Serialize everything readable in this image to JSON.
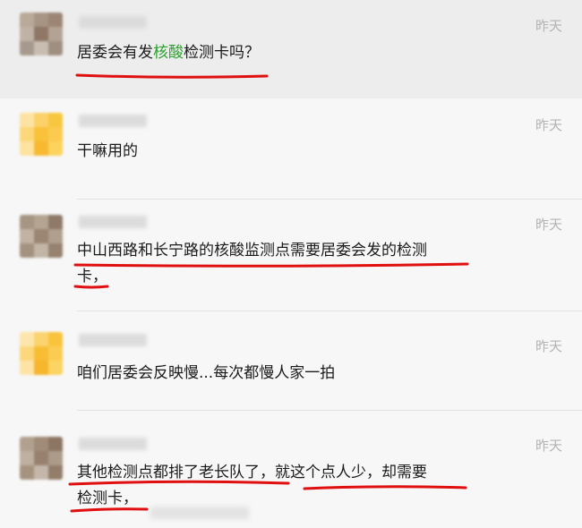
{
  "comments": [
    {
      "time": "昨天",
      "text_pre": "居委会有发",
      "text_highlight": "核酸",
      "text_post": "检测卡吗？",
      "avatar_colors": [
        "#b8a999",
        "#a89484",
        "#9c8574",
        "#c0b3a6",
        "#8f7765",
        "#b3a394",
        "#a7998d",
        "#c9bdb1",
        "#9f8f80"
      ]
    },
    {
      "time": "昨天",
      "text": "干嘛用的",
      "avatar_colors": [
        "#fde3a3",
        "#fbd16a",
        "#f8c740",
        "#fcd779",
        "#f9c23a",
        "#fbca4e",
        "#fde2a0",
        "#f7b932",
        "#fcd35d"
      ]
    },
    {
      "time": "昨天",
      "line1": "中山西路和长宁路的核酸监测点需要居委会发的检测",
      "line2": "卡，",
      "avatar_colors": [
        "#a79583",
        "#b5a493",
        "#8f7a69",
        "#c1b2a3",
        "#9b8573",
        "#b09f8f",
        "#a4927f",
        "#c2b5a7",
        "#96826f"
      ]
    },
    {
      "time": "昨天",
      "text": "咱们居委会反映慢...每次都慢人家一拍",
      "avatar_colors": [
        "#fde6ad",
        "#fbd36f",
        "#f9c43c",
        "#fcd77c",
        "#f8bd35",
        "#fbcc52",
        "#fde4a6",
        "#f6b62e",
        "#fcd463"
      ]
    },
    {
      "time": "昨天",
      "line1": "其他检测点都排了老长队了，就这个点人少，却需要",
      "line2": "检测卡，",
      "avatar_colors": [
        "#b2a08f",
        "#a08b79",
        "#8c7663",
        "#bfb0a1",
        "#97816e",
        "#ad9b8a",
        "#a6937f",
        "#c4b7a9",
        "#927d6a"
      ]
    }
  ],
  "theme": {
    "highlight": "#2ca02c",
    "underline": "#e01010",
    "time_color": "#b3b3b3"
  }
}
